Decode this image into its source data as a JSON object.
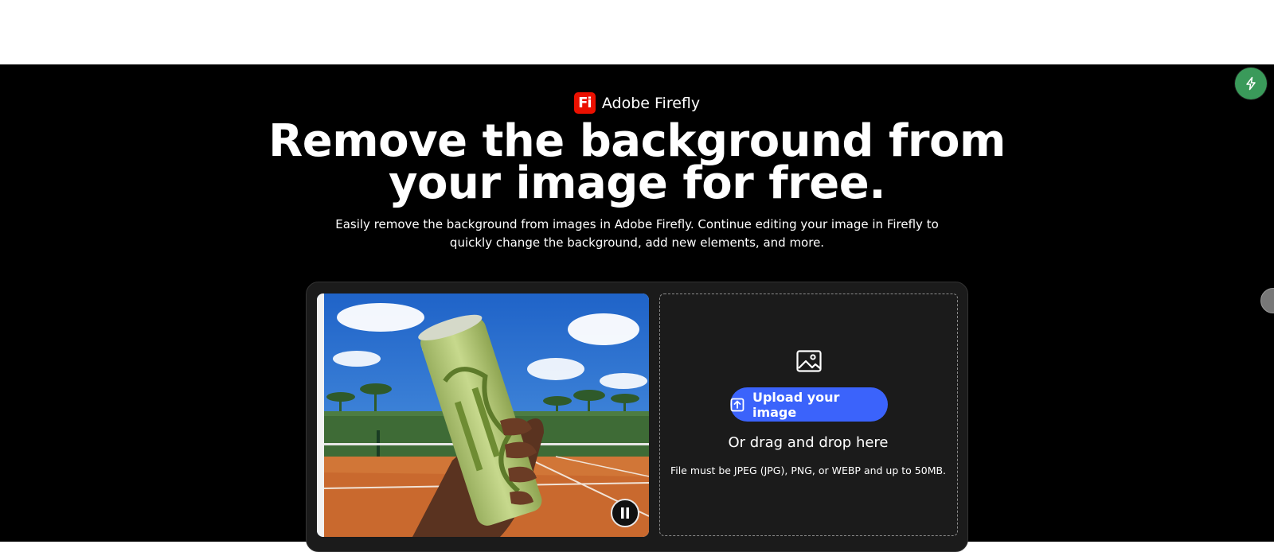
{
  "brand": {
    "name": "Adobe Firefly",
    "logo_text": "Fi",
    "logo_color": "#eb1000"
  },
  "hero": {
    "title": "Remove the background from your image for free.",
    "subtitle": "Easily remove the background from images in Adobe Firefly. Continue editing your image in Firefly to quickly change the background, add new elements, and more."
  },
  "media": {
    "playback_state": "playing",
    "control_icon": "pause-icon"
  },
  "upload": {
    "icon": "image-icon",
    "button_label": "Upload your image",
    "button_icon": "upload-icon",
    "button_color": "#3b63fb",
    "drag_text": "Or drag and drop here",
    "file_note": "File must be JPEG (JPG), PNG, or WEBP and up to 50MB."
  },
  "floating": {
    "action_icon": "bolt-icon",
    "action_color": "#3a9a5a",
    "side_icon": "avatar-icon"
  }
}
